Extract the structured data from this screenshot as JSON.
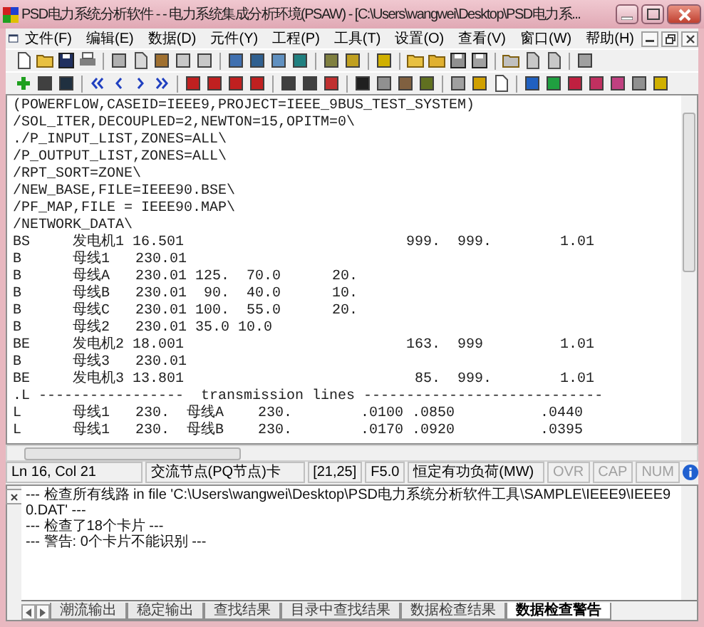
{
  "window": {
    "title": "PSD电力系统分析软件 - - 电力系统集成分析环境(PSAW) - [C:\\Users\\wangwei\\Desktop\\PSD电力系..."
  },
  "menu": [
    "文件(F)",
    "编辑(E)",
    "数据(D)",
    "元件(Y)",
    "工程(P)",
    "工具(T)",
    "设置(O)",
    "查看(V)",
    "窗口(W)",
    "帮助(H)"
  ],
  "editor": {
    "lines": [
      "(POWERFLOW,CASEID=IEEE9,PROJECT=IEEE_9BUS_TEST_SYSTEM)",
      "/SOL_ITER,DECOUPLED=2,NEWTON=15,OPITM=0\\",
      "./P_INPUT_LIST,ZONES=ALL\\",
      "/P_OUTPUT_LIST,ZONES=ALL\\",
      "/RPT_SORT=ZONE\\",
      "/NEW_BASE,FILE=IEEE90.BSE\\",
      "/PF_MAP,FILE = IEEE90.MAP\\",
      "/NETWORK_DATA\\",
      "BS     发电机1 16.501                          999.  999.        1.01",
      "B      母线1   230.01",
      "B      母线A   230.01 125.  70.0      20.",
      "B      母线B   230.01  90.  40.0      10.",
      "B      母线C   230.01 100.  55.0      20.",
      "B      母线2   230.01 35.0 10.0",
      "BE     发电机2 18.001                          163.  999         1.01",
      "B      母线3   230.01",
      "BE     发电机3 13.801                           85.  999.        1.01",
      ".L -----------------  transmission lines ----------------------------",
      "L      母线1   230.  母线A    230.        .0100 .0850          .0440",
      "L      母线1   230.  母线B    230.        .0170 .0920          .0395"
    ]
  },
  "status_bar": [
    {
      "text": "Ln 16, Col 21",
      "disabled": false
    },
    {
      "text": "交流节点(PQ节点)卡",
      "disabled": false
    },
    {
      "text": "[21,25]",
      "disabled": false
    },
    {
      "text": "F5.0",
      "disabled": false
    },
    {
      "text": "恒定有功负荷(MW)",
      "disabled": false
    },
    {
      "text": "OVR",
      "disabled": true
    },
    {
      "text": "CAP",
      "disabled": true
    },
    {
      "text": "NUM",
      "disabled": true
    }
  ],
  "output": {
    "lines": [
      "--- 检查所有线路 in file 'C:\\Users\\wangwei\\Desktop\\PSD电力系统分析软件工具\\SAMPLE\\IEEE9\\IEEE90.DAT' ---",
      "--- 检查了18个卡片 ---",
      "--- 警告: 0个卡片不能识别 ---"
    ],
    "tabs": [
      {
        "label": "潮流输出",
        "selected": false
      },
      {
        "label": "稳定输出",
        "selected": false
      },
      {
        "label": "查找结果",
        "selected": false
      },
      {
        "label": "目录中查找结果",
        "selected": false
      },
      {
        "label": "数据检查结果",
        "selected": false
      },
      {
        "label": "数据检查警告",
        "selected": true
      }
    ]
  }
}
